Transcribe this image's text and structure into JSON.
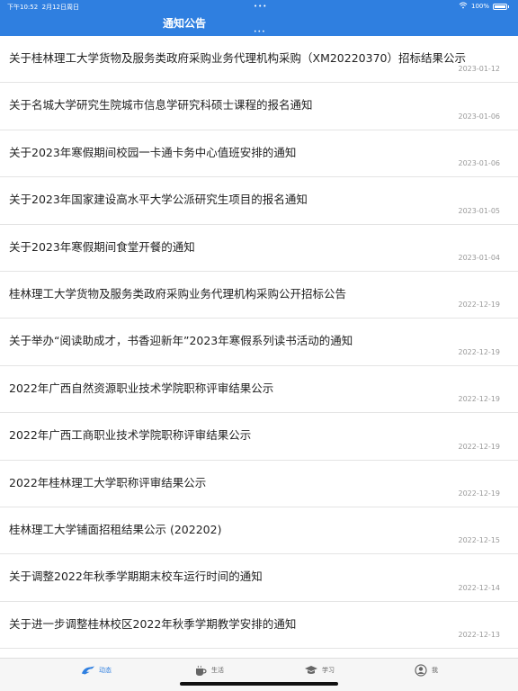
{
  "status": {
    "time": "下午10:52",
    "date": "2月12日周日",
    "battery": "100%"
  },
  "header": {
    "title": "通知公告"
  },
  "colors": {
    "accent": "#2f7fe0",
    "date_text": "#999999",
    "divider": "#e4e4e4"
  },
  "notices": [
    {
      "title": "关于桂林理工大学货物及服务类政府采购业务代理机构采购（XM20220370）招标结果公示",
      "date": "2023-01-12"
    },
    {
      "title": "关于名城大学研究生院城市信息学研究科硕士课程的报名通知",
      "date": "2023-01-06"
    },
    {
      "title": "关于2023年寒假期间校园一卡通卡务中心值班安排的通知",
      "date": "2023-01-06"
    },
    {
      "title": "关于2023年国家建设高水平大学公派研究生项目的报名通知",
      "date": "2023-01-05"
    },
    {
      "title": "关于2023年寒假期间食堂开餐的通知",
      "date": "2023-01-04"
    },
    {
      "title": "桂林理工大学货物及服务类政府采购业务代理机构采购公开招标公告",
      "date": "2022-12-19"
    },
    {
      "title": "关于举办“阅读助成才，书香迎新年”2023年寒假系列读书活动的通知",
      "date": "2022-12-19"
    },
    {
      "title": "2022年广西自然资源职业技术学院职称评审结果公示",
      "date": "2022-12-19"
    },
    {
      "title": "2022年广西工商职业技术学院职称评审结果公示",
      "date": "2022-12-19"
    },
    {
      "title": "2022年桂林理工大学职称评审结果公示",
      "date": "2022-12-19"
    },
    {
      "title": "桂林理工大学铺面招租结果公示 (202202)",
      "date": "2022-12-15"
    },
    {
      "title": "关于调整2022年秋季学期期末校车运行时间的通知",
      "date": "2022-12-14"
    },
    {
      "title": "关于进一步调整桂林校区2022年秋季学期教学安排的通知",
      "date": "2022-12-13"
    }
  ],
  "tabs": [
    {
      "label": "动态",
      "icon": "feed-icon"
    },
    {
      "label": "生活",
      "icon": "coffee-cup-icon"
    },
    {
      "label": "学习",
      "icon": "graduation-cap-icon"
    },
    {
      "label": "我",
      "icon": "user-icon"
    }
  ]
}
